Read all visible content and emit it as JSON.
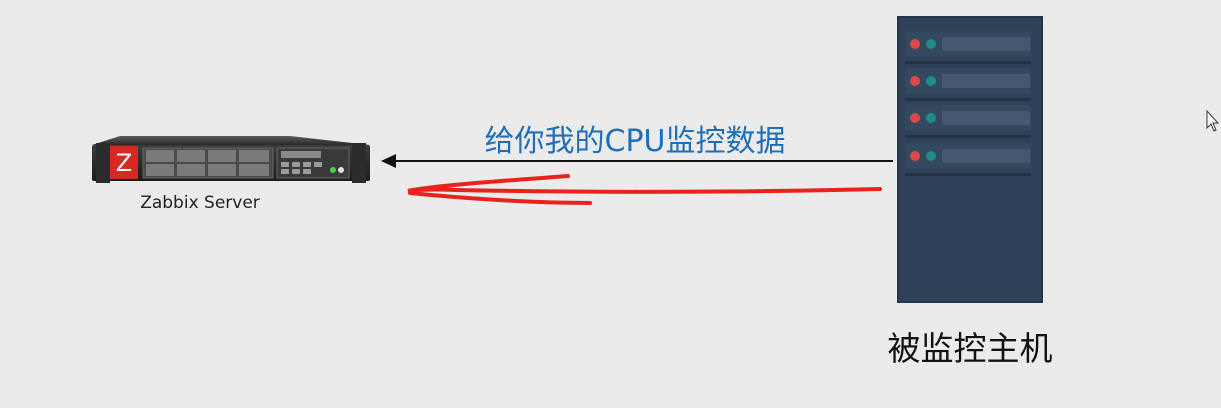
{
  "server": {
    "label": "Zabbix Server",
    "logo_letter": "Z"
  },
  "arrow": {
    "label": "给你我的CPU监控数据"
  },
  "host": {
    "label": "被监控主机"
  },
  "icons": {
    "server": "rack-server-icon",
    "host": "tower-server-icon",
    "cursor": "mouse-cursor-icon"
  },
  "colors": {
    "label_blue": "#1f6fb8",
    "annotation_red": "#e8231c",
    "tower_body": "#2f4158",
    "logo_red": "#d42a22"
  }
}
